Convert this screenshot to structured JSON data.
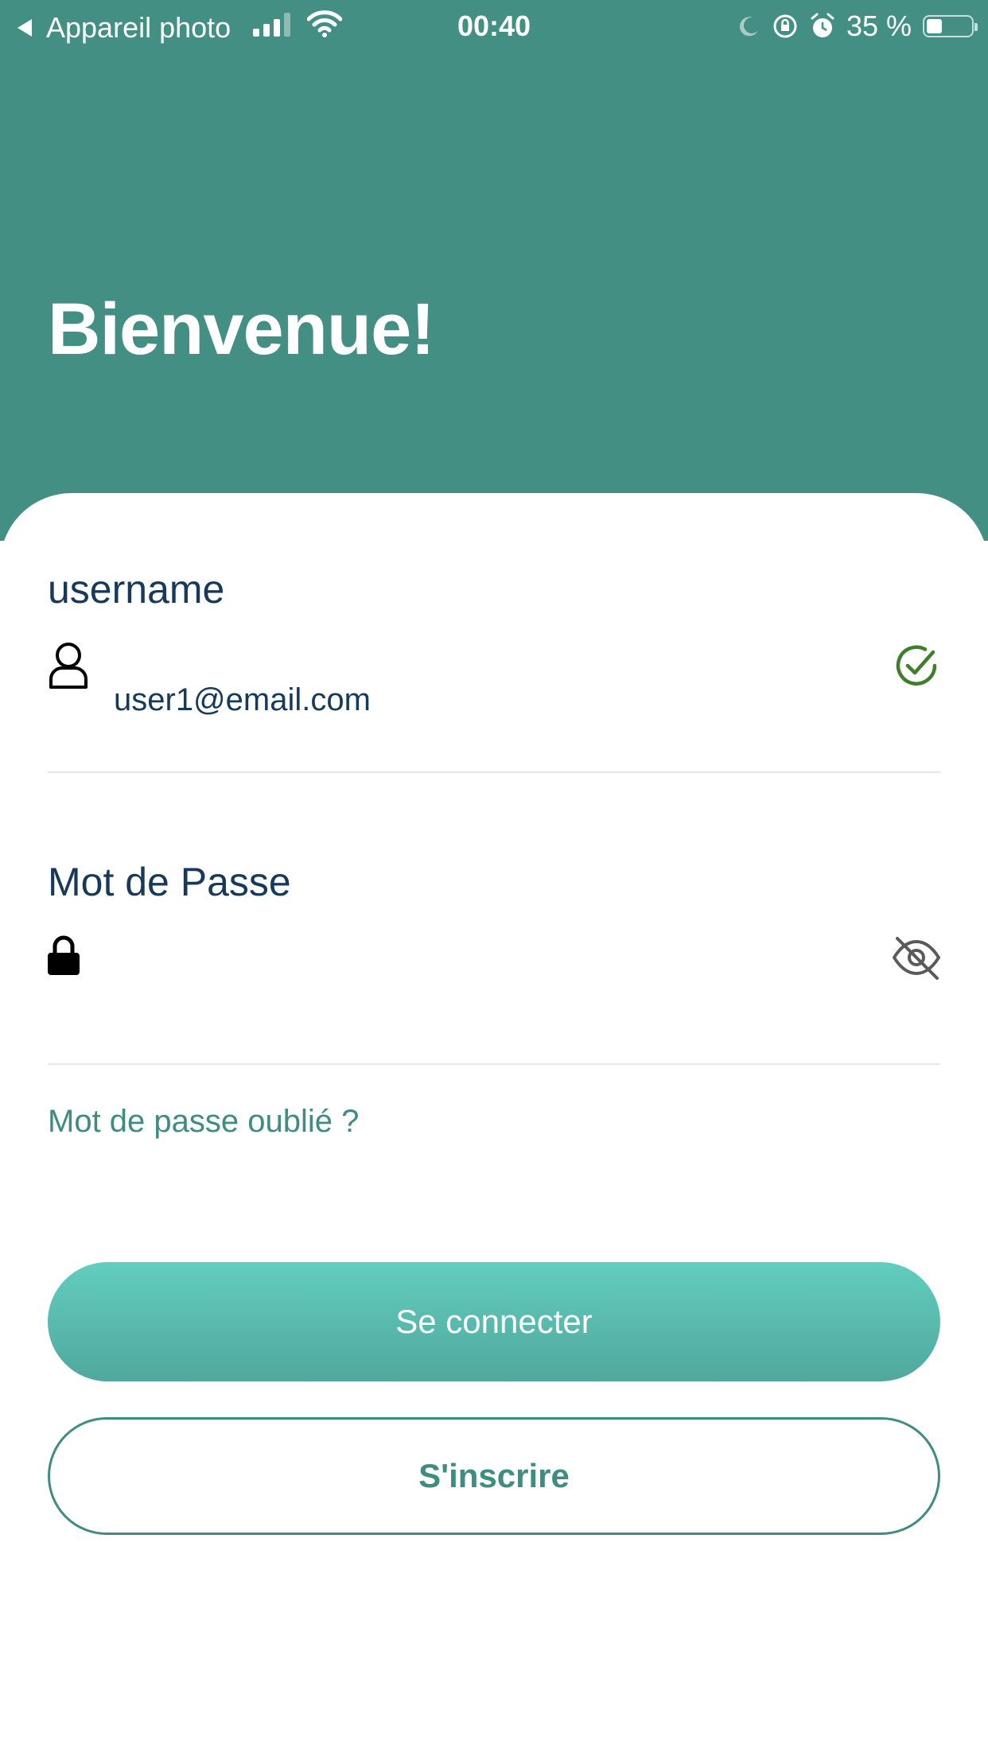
{
  "status_bar": {
    "back_app": "Appareil photo",
    "time": "00:40",
    "battery": "35 %"
  },
  "header": {
    "title": "Bienvenue!"
  },
  "form": {
    "username": {
      "label": "username",
      "value": "user1@email.com",
      "icon": "user-icon",
      "status_icon": "check-circle-icon"
    },
    "password": {
      "label": "Mot de Passe",
      "value": "",
      "icon": "lock-icon",
      "toggle_icon": "eye-off-icon"
    },
    "forgot_label": "Mot de passe oublié ?"
  },
  "actions": {
    "login_label": "Se connecter",
    "signup_label": "S'inscrire"
  },
  "colors": {
    "header_bg": "#448f84",
    "accent": "#3f8c82",
    "text_dark": "#173a5a",
    "success": "#3f7f2a"
  }
}
